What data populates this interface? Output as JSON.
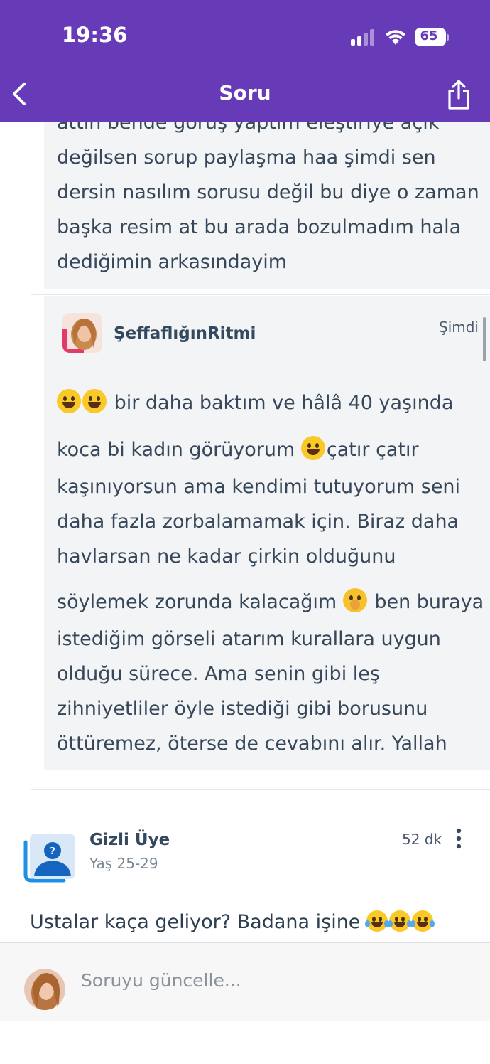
{
  "status_bar": {
    "time": "19:36",
    "battery": "65",
    "battery_level": 0.65
  },
  "header": {
    "title": "Soru",
    "accent_color": "#673ab7"
  },
  "replies": [
    {
      "lines": [
        "değilsen sorup paylaşma haa şimdi sen",
        "dersin nasılım sorusu değil bu diye o zaman",
        "başka resim at bu arada bozulmadım hala",
        "dediğimin arkasındayim"
      ]
    },
    {
      "author": "ŞeffaflığınRitmi",
      "time": "Şimdi",
      "segments": {
        "l1": "bir daha baktım ve hâlâ 40 yaşında",
        "l2a": "koca bi kadın görüyorum ",
        "l2b": "çatır çatır",
        "l3": "kaşınıyorsun ama kendimi tutuyorum seni",
        "l4": "daha fazla zorbalamamak için. Biraz daha",
        "l5": "havlarsan ne kadar çirkin olduğunu",
        "l6a": "söylemek zorunda kalacağım ",
        "l6b": " ben buraya",
        "l7": "istediğim görseli atarım kurallara uygun",
        "l8": "olduğu sürece. Ama senin gibi leş",
        "l9": "zihniyetliler öyle istediği gibi borusunu",
        "l10": "öttüremez, öterse de cevabını alır. Yallah"
      },
      "emojis": [
        "grinning-emoji",
        "grinning-emoji",
        "grinning-emoji",
        "face-with-hand-over-mouth-emoji"
      ]
    }
  ],
  "comment": {
    "author": "Gizli Üye",
    "age": "Yaş 25-29",
    "time": "52 dk",
    "text": "Ustalar kaça geliyor? Badana işine",
    "emojis": [
      "tears-of-joy-emoji",
      "tears-of-joy-emoji",
      "tears-of-joy-emoji"
    ]
  },
  "composer": {
    "placeholder": "Soruyu güncelle..."
  }
}
